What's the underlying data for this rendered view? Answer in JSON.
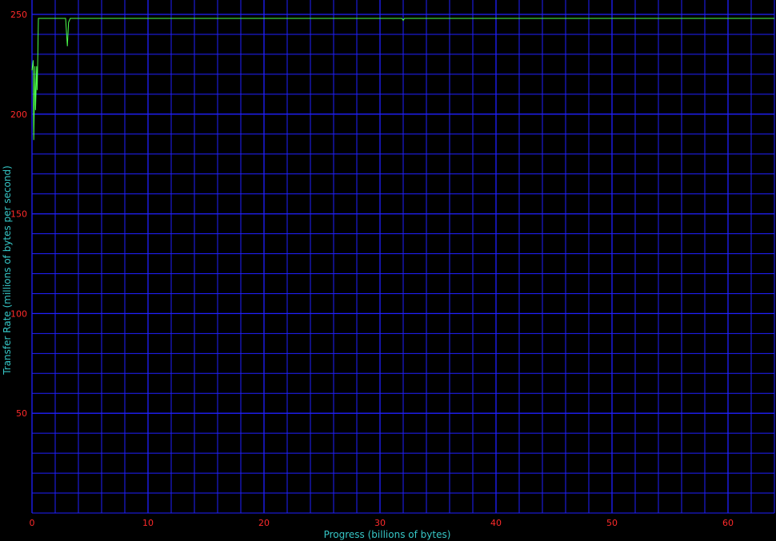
{
  "chart_data": {
    "type": "line",
    "xlabel": "Progress (billions of bytes)",
    "ylabel": "Transfer Rate (millions of bytes per second)",
    "xlim": [
      0,
      64
    ],
    "ylim": [
      0,
      250
    ],
    "x_ticks": [
      0,
      10,
      20,
      30,
      40,
      50,
      60
    ],
    "y_ticks": [
      50,
      100,
      150,
      200,
      250
    ],
    "x_minor_step": 2,
    "y_minor_step": 10,
    "grid": true,
    "legend": "none",
    "series": [
      {
        "color": "#4cff4c",
        "x": [
          0.0,
          0.1,
          0.15,
          0.2,
          0.25,
          0.3,
          0.35,
          0.4,
          0.45,
          0.5,
          0.55,
          0.6,
          0.7,
          0.8,
          1.0,
          1.5,
          2.0,
          2.5,
          2.9,
          3.05,
          3.15,
          3.3,
          3.5,
          4.0,
          5.0,
          6.0,
          8.0,
          10.0,
          12.0,
          14.0,
          16.0,
          18.0,
          20.0,
          22.0,
          24.0,
          26.0,
          28.0,
          30.0,
          31.9,
          32.0,
          32.1,
          34.0,
          36.0,
          38.0,
          40.0,
          42.0,
          44.0,
          46.0,
          48.0,
          50.0,
          52.0,
          54.0,
          56.0,
          58.0,
          60.0,
          62.0,
          64.0
        ],
        "values": [
          222,
          227,
          187,
          205,
          224,
          202,
          212,
          224,
          212,
          230,
          248,
          248,
          248,
          248,
          248,
          248,
          248,
          248,
          248,
          234,
          246,
          248,
          248,
          248,
          248,
          248,
          248,
          248,
          248,
          248,
          248,
          248,
          248,
          248,
          248,
          248,
          248,
          248,
          248,
          247,
          248,
          248,
          248,
          248,
          248,
          248,
          248,
          248,
          248,
          248,
          248,
          248,
          248,
          248,
          248,
          248,
          248
        ]
      }
    ],
    "colors": {
      "background": "#000000",
      "grid": "#2020ff",
      "tick_label": "#ff2a2a",
      "axis_title": "#36c7c7",
      "series": "#4cff4c"
    }
  }
}
